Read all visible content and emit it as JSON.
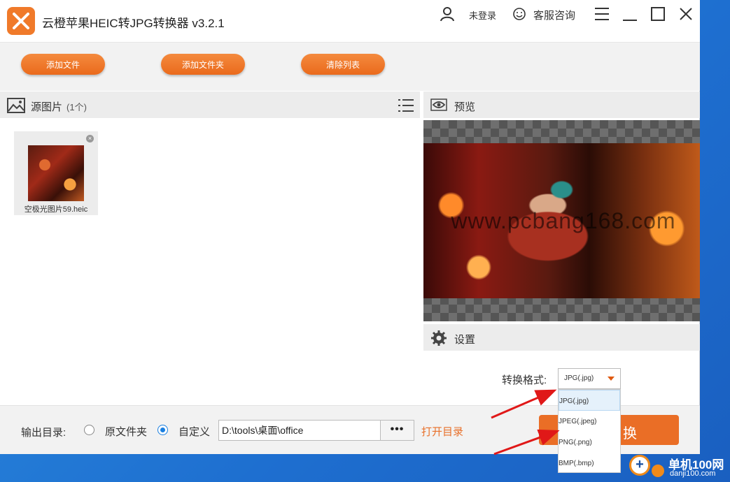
{
  "app": {
    "title": "云橙苹果HEIC转JPG转换器 v3.2.1",
    "logo_icon": "app-logo-icon"
  },
  "titlebar": {
    "user_label": "未登录",
    "service_label": "客服咨询"
  },
  "toolbar": {
    "add_file": "添加文件",
    "add_folder": "添加文件夹",
    "clear_list": "清除列表"
  },
  "source": {
    "title": "源图片",
    "count": "(1个)",
    "files": [
      {
        "name": "空极光图片59.heic"
      }
    ]
  },
  "preview": {
    "title": "预览",
    "watermark": "www.pcbang168.com"
  },
  "settings": {
    "title": "设置",
    "format_label": "转换格式:",
    "format_value": "JPG(.jpg)",
    "format_options": [
      "JPG(.jpg)",
      "JPEG(.jpeg)",
      "PNG(.png)",
      "BMP(.bmp)"
    ]
  },
  "output": {
    "label": "输出目录:",
    "option_original": "原文件夹",
    "option_custom": "自定义",
    "selected": "custom",
    "path": "D:\\tools\\桌面\\office",
    "browse": "•••",
    "open_dir": "打开目录"
  },
  "convert": {
    "label": "换"
  },
  "site": {
    "name": "单机100网",
    "url": "danji100.com"
  },
  "colors": {
    "accent": "#ea6e26",
    "link": "#e8702a",
    "radio": "#1a7fe0"
  }
}
